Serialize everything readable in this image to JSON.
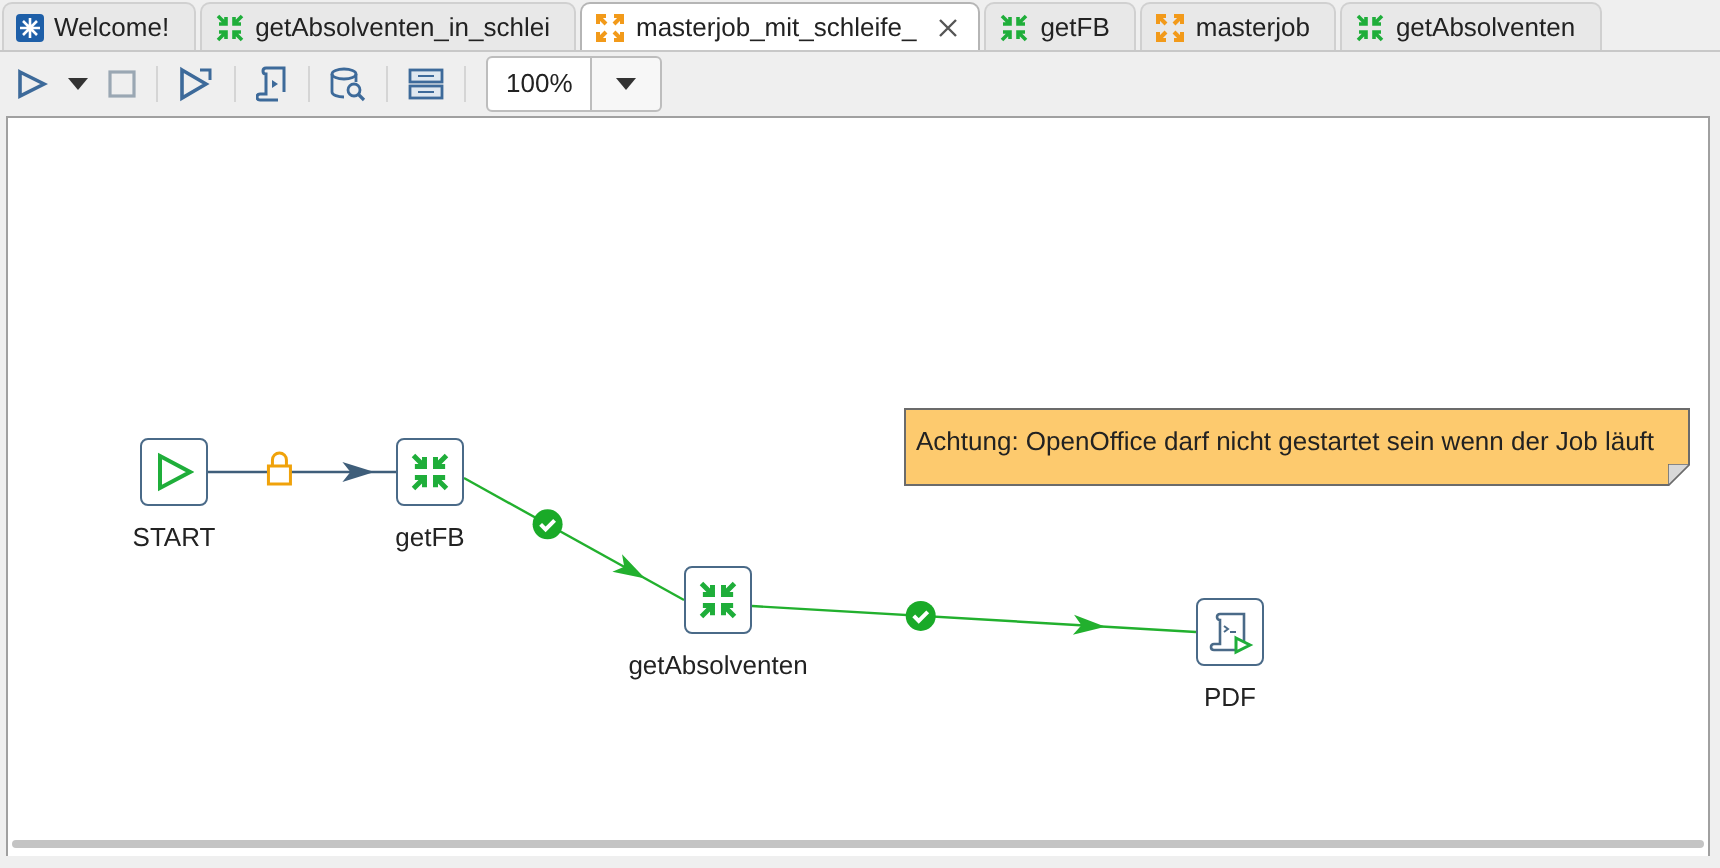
{
  "tabs": [
    {
      "label": "Welcome!",
      "kind": "welcome",
      "selected": false
    },
    {
      "label": "getAbsolventen_in_schlei",
      "kind": "job",
      "selected": false
    },
    {
      "label": "masterjob_mit_schleife_",
      "kind": "master",
      "selected": true
    },
    {
      "label": "getFB",
      "kind": "job",
      "selected": false
    },
    {
      "label": "masterjob",
      "kind": "master",
      "selected": false
    },
    {
      "label": "getAbsolventen",
      "kind": "job",
      "selected": false
    }
  ],
  "toolbar": {
    "zoom": "100%"
  },
  "canvas": {
    "nodes": [
      {
        "label": "START",
        "kind": "start"
      },
      {
        "label": "getFB",
        "kind": "job"
      },
      {
        "label": "getAbsolventen",
        "kind": "job"
      },
      {
        "label": "PDF",
        "kind": "script"
      }
    ],
    "edges": [
      {
        "kind": "unconditional"
      },
      {
        "kind": "success"
      },
      {
        "kind": "success"
      }
    ],
    "note": {
      "text": "Achtung: OpenOffice darf nicht gestartet sein wenn der Job läuft"
    }
  }
}
